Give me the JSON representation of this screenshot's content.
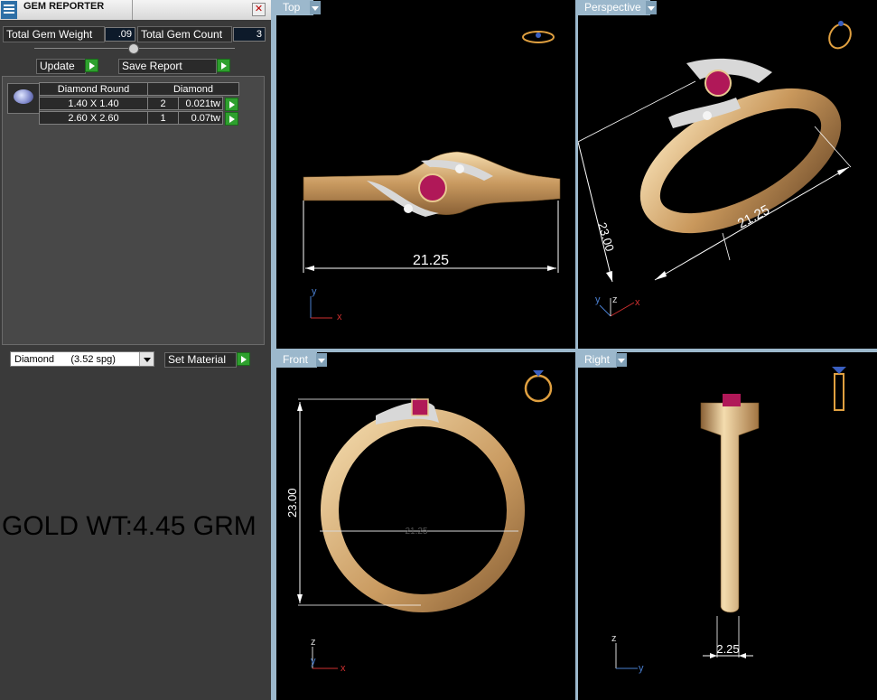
{
  "app": {
    "title": "GEM REPORTER"
  },
  "stats": {
    "total_gem_weight_label": "Total Gem Weight",
    "total_gem_weight_value": ".09",
    "total_gem_count_label": "Total Gem Count",
    "total_gem_count_value": "3"
  },
  "buttons": {
    "update": "Update",
    "save_report": "Save Report",
    "set_material": "Set Material"
  },
  "gem_table": {
    "headers": [
      "Diamond Round",
      "Diamond"
    ],
    "rows": [
      {
        "size": "1.40 X 1.40",
        "count": "2",
        "weight": "0.021tw"
      },
      {
        "size": "2.60 X 2.60",
        "count": "1",
        "weight": "0.07tw"
      }
    ]
  },
  "material": {
    "selected": "Diamond      (3.52 spg)"
  },
  "gold_weight": "GOLD WT:4.45 GRM",
  "viewports": {
    "top": {
      "label": "Top",
      "dimension": "21.25"
    },
    "perspective": {
      "label": "Perspective",
      "dimension_width": "21.25",
      "dimension_height": "23.00"
    },
    "front": {
      "label": "Front",
      "dimension_height": "23.00",
      "dimension_width": "21.25"
    },
    "right": {
      "label": "Right",
      "dimension": "2.25"
    }
  },
  "axes": {
    "x": "x",
    "y": "y",
    "z": "z"
  },
  "colors": {
    "gold": "#d4a870",
    "ruby": "#b01858",
    "axis_x": "#d03030",
    "axis_y": "#4a7fd0",
    "axis_z": "#d8d8d8",
    "icon": "#e0a040"
  }
}
